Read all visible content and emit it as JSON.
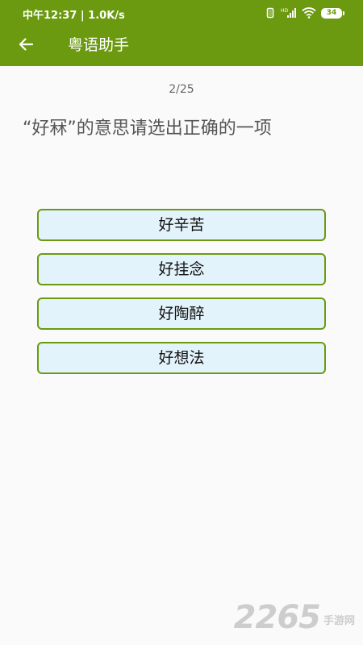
{
  "status_bar": {
    "time_speed": "中午12:37 | 1.0K/s",
    "battery": "34",
    "hd_label": "HD"
  },
  "app_bar": {
    "title": "粤语助手",
    "back_icon": "arrow-left-icon"
  },
  "quiz": {
    "progress": "2/25",
    "question": "“好冧”的意思请选出正确的一项",
    "options": [
      {
        "label": "好辛苦"
      },
      {
        "label": "好挂念"
      },
      {
        "label": "好陶醉"
      },
      {
        "label": "好想法"
      }
    ]
  },
  "watermark": {
    "number": "2265",
    "text": "手游网"
  },
  "colors": {
    "brand_green": "#6b9a10",
    "option_background": "#e3f3fb",
    "page_background": "#fafafa"
  }
}
